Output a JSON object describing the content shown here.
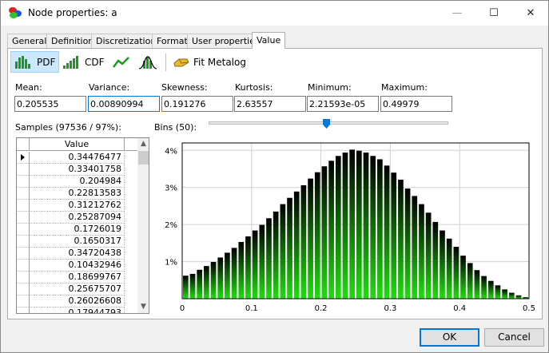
{
  "window": {
    "title": "Node properties: a",
    "minimize_glyph": "—",
    "maximize_glyph": "☐",
    "close_glyph": "✕"
  },
  "tabs": [
    {
      "label": "General"
    },
    {
      "label": "Definition"
    },
    {
      "label": "Discretization"
    },
    {
      "label": "Format"
    },
    {
      "label": "User properties"
    },
    {
      "label": "Value",
      "active": true
    }
  ],
  "toolbar": {
    "pdf_label": "PDF",
    "cdf_label": "CDF",
    "fit_label": "Fit Metalog",
    "icons": [
      "pdf-bars-icon",
      "cdf-bars-icon",
      "line-chart-icon",
      "bell-curve-icon",
      "fit-metalog-icon"
    ]
  },
  "stats": {
    "mean": {
      "label": "Mean:",
      "value": "0.205535"
    },
    "variance": {
      "label": "Variance:",
      "value": "0.00890994"
    },
    "skewness": {
      "label": "Skewness:",
      "value": "0.191276"
    },
    "kurtosis": {
      "label": "Kurtosis:",
      "value": "2.63557"
    },
    "minimum": {
      "label": "Minimum:",
      "value": "2.21593e-05"
    },
    "maximum": {
      "label": "Maximum:",
      "value": "0.49979"
    }
  },
  "samples": {
    "label": "Samples (97536 / 97%):",
    "column_header": "Value",
    "values": [
      "0.34476477",
      "0.33401758",
      "0.204984",
      "0.22813583",
      "0.31212762",
      "0.25287094",
      "0.1726019",
      "0.1650317",
      "0.34720438",
      "0.10432946",
      "0.18699767",
      "0.25675707",
      "0.26026608",
      "0.17944793"
    ]
  },
  "bins": {
    "label": "Bins (50):",
    "count": 50,
    "slider_fraction": 0.49
  },
  "chart_data": {
    "type": "bar",
    "xlim": [
      0,
      0.5
    ],
    "ylim": [
      0,
      4.2
    ],
    "x_ticks": [
      "0",
      "0.1",
      "0.2",
      "0.3",
      "0.4",
      "0.5"
    ],
    "x_tick_values": [
      0,
      0.1,
      0.2,
      0.3,
      0.4,
      0.5
    ],
    "y_ticks": [
      "1%",
      "2%",
      "3%",
      "4%"
    ],
    "y_tick_values": [
      1,
      2,
      3,
      4
    ],
    "bin_start": 0,
    "bin_width": 0.01,
    "values": [
      0.62,
      0.67,
      0.78,
      0.88,
      0.99,
      1.11,
      1.24,
      1.37,
      1.53,
      1.68,
      1.84,
      1.99,
      2.17,
      2.35,
      2.55,
      2.72,
      2.89,
      3.06,
      3.24,
      3.41,
      3.57,
      3.72,
      3.85,
      3.94,
      4.02,
      3.99,
      3.94,
      3.85,
      3.76,
      3.59,
      3.4,
      3.21,
      2.97,
      2.77,
      2.55,
      2.32,
      2.07,
      1.84,
      1.62,
      1.4,
      1.16,
      0.96,
      0.77,
      0.61,
      0.48,
      0.36,
      0.25,
      0.16,
      0.09,
      0.04
    ],
    "bar_color_top": "#000000",
    "bar_color_bottom": "#22dd11",
    "grid": true
  },
  "buttons": {
    "ok": "OK",
    "cancel": "Cancel"
  }
}
